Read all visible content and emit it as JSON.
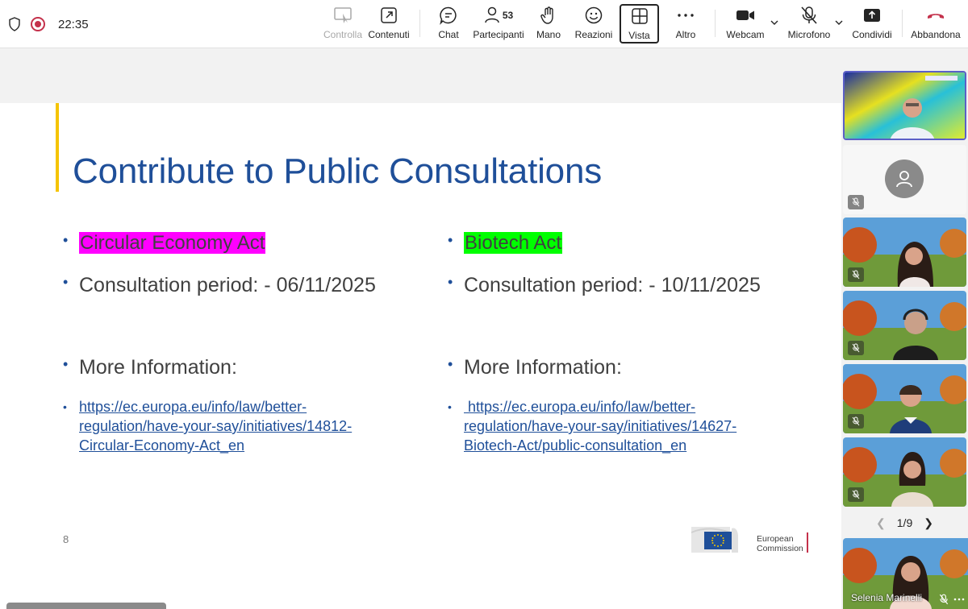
{
  "topbar": {
    "time": "22:35",
    "buttons": {
      "control": "Controlla",
      "content": "Contenuti",
      "chat": "Chat",
      "participants": "Partecipanti",
      "participants_count": "53",
      "raise_hand": "Mano",
      "reactions": "Reazioni",
      "view": "Vista",
      "more": "Altro",
      "camera": "Webcam",
      "mic": "Microfono",
      "share": "Condividi",
      "leave": "Abbandona"
    },
    "colors": {
      "leave": "#c4314b",
      "record": "#c4314b"
    }
  },
  "slide": {
    "title": "Contribute to Public Consultations",
    "left": {
      "name": "Circular Economy Act",
      "period": "Consultation period: - 06/11/2025",
      "more": "More Information:",
      "link_lines": [
        "https://ec.europa.eu/info/law/better-",
        "regulation/have-your-say/initiatives/14812-",
        "Circular-Economy-Act_en"
      ],
      "highlight": "#ff00ff"
    },
    "right": {
      "name": "Biotech Act",
      "period": "Consultation period: - 10/11/2025",
      "more": "More Information:",
      "link_lines": [
        " https://ec.europa.eu/info/law/better-",
        "regulation/have-your-say/initiatives/14627-",
        "Biotech-Act/public-consultation_en"
      ],
      "highlight": "#00ff00"
    },
    "page_number": "8",
    "logo_line1": "European",
    "logo_line2": "Commission",
    "colors": {
      "title": "#1f4f99",
      "accent": "#f5c400"
    }
  },
  "panel": {
    "pager": "1/9",
    "speaker_name": "Selenia Marinelli"
  }
}
